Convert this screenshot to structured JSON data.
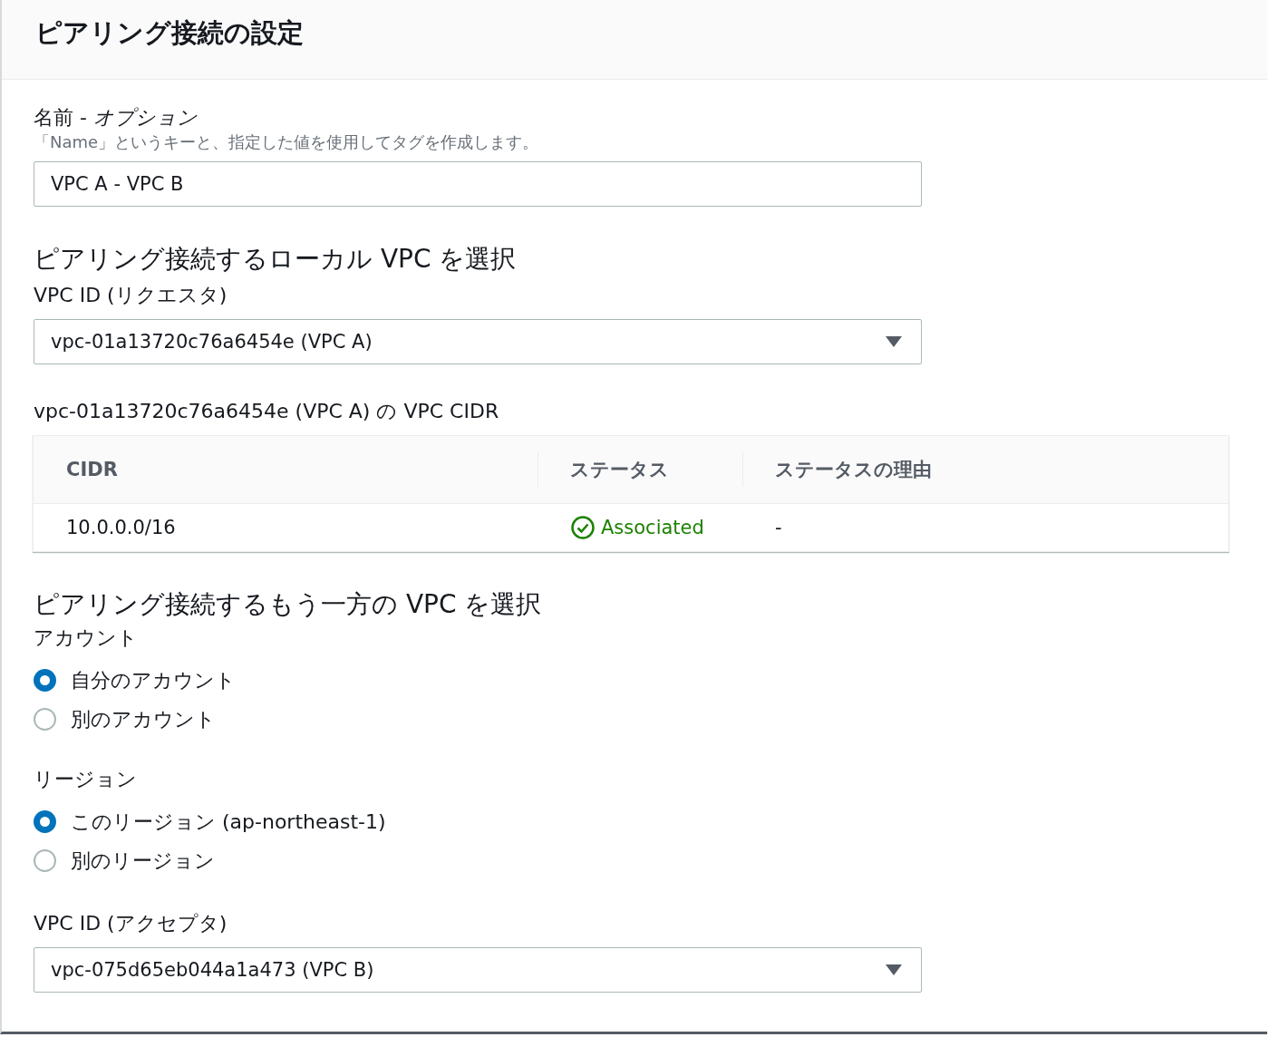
{
  "panel": {
    "title": "ピアリング接続の設定"
  },
  "name_field": {
    "label": "名前 - *オプション*",
    "description": "「Name」というキーと、指定した値を使用してタグを作成します。",
    "value": "VPC A - VPC B"
  },
  "local_vpc": {
    "heading": "ピアリング接続するローカル VPC を選択",
    "vpc_id_label": "VPC ID (リクエスタ)",
    "vpc_select": {
      "value": "vpc-01a13720c76a6454e (VPC A)"
    },
    "cidr_title": "vpc-01a13720c76a6454e (VPC A) の VPC CIDR",
    "cidr_table": {
      "columns": [
        "CIDR",
        "ステータス",
        "ステータスの理由"
      ],
      "rows": [
        {
          "cidr": "10.0.0.0/16",
          "status": {
            "text": "Associated",
            "kind": "success"
          },
          "reason": "-"
        }
      ]
    }
  },
  "peer_vpc": {
    "heading": "ピアリング接続するもう一方の VPC を選択",
    "account": {
      "label": "アカウント",
      "options": [
        {
          "label": "自分のアカウント",
          "selected": true
        },
        {
          "label": "別のアカウント",
          "selected": false
        }
      ]
    },
    "region": {
      "label": "リージョン",
      "options": [
        {
          "label": "このリージョン (ap-northeast-1)",
          "selected": true
        },
        {
          "label": "別のリージョン",
          "selected": false
        }
      ]
    },
    "vpc_id_label": "VPC ID (アクセプタ)",
    "vpc_select": {
      "value": "vpc-075d65eb044a1a473 (VPC B)"
    }
  }
}
